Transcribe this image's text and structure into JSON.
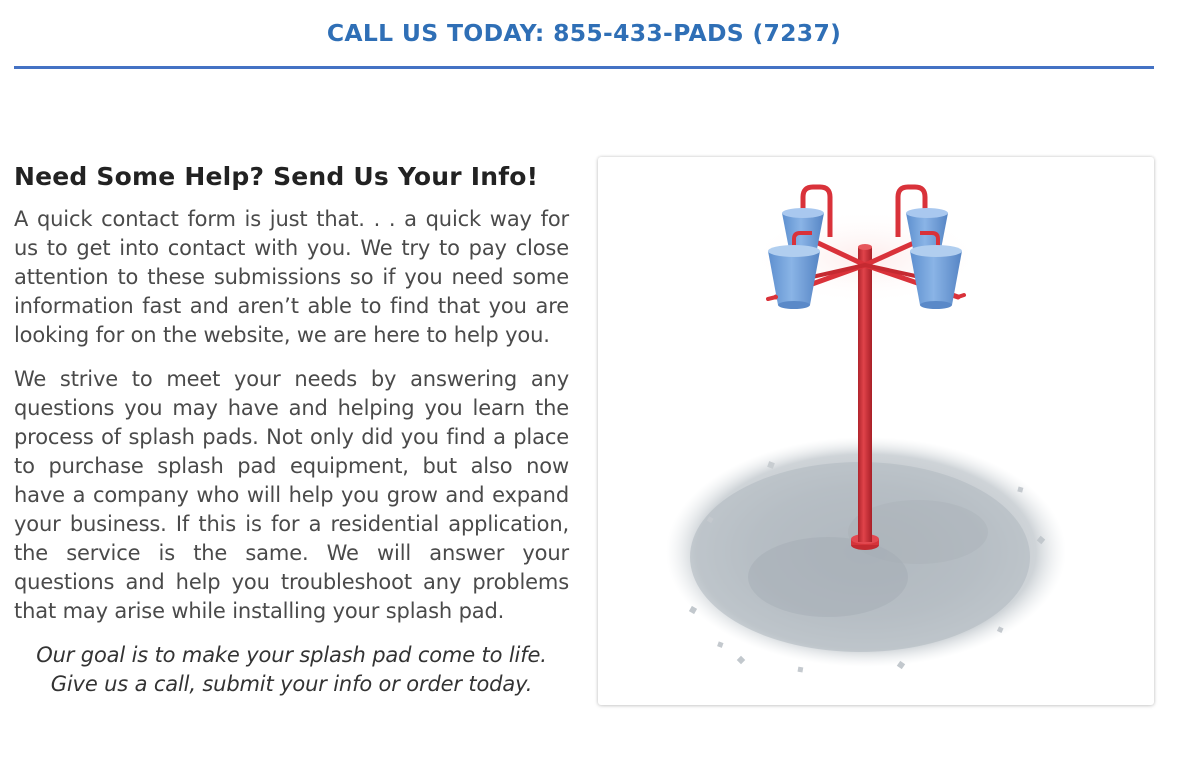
{
  "header": {
    "call_text": "CALL US TODAY: 855-433-PADS (7237)"
  },
  "main": {
    "heading": "Need Some Help? Send Us Your Info!",
    "paragraph_1": "A quick contact form is just that. . . a quick way for us to get into contact with you. We try to pay close attention to these submissions so if you need some information fast and aren’t able to find that you are looking for on the website, we are here to help you.",
    "paragraph_2": "We strive to meet your needs by answering any questions you may have and helping you learn the process of splash pads.  Not only did you find a place to purchase splash pad equipment, but also now have a company who will help you grow and expand your business.  If this is for a residential application, the service is the same.  We will answer your questions and help you troubleshoot any problems that may arise while installing your splash pad.",
    "goal_line_1": "Our goal is to make your splash pad come to life.",
    "goal_line_2": "Give us a call, submit your info or order today."
  },
  "product_image": {
    "icon": "tipping-buckets-splash-feature-image",
    "colors": {
      "pole": "#d9323a",
      "bucket": "#6f9ed8",
      "ground": "#b8bec4"
    }
  },
  "colors": {
    "accent": "#2f6fb6",
    "rule": "#4472c4",
    "heading": "#222222",
    "body_text": "#4a4a4a"
  }
}
